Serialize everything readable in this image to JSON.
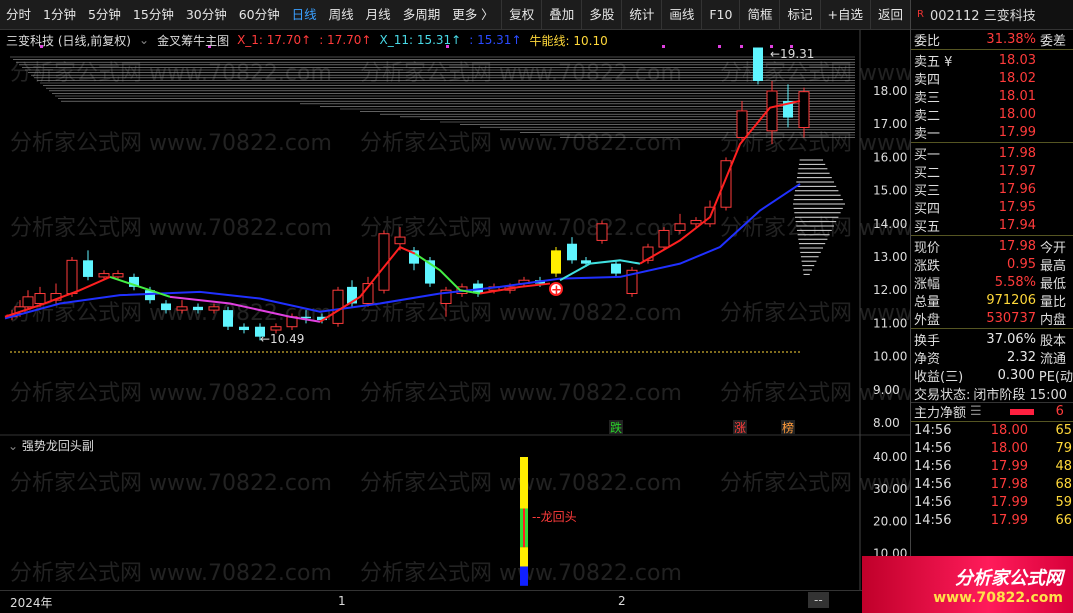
{
  "toolbar": {
    "periods": [
      "分时",
      "1分钟",
      "5分钟",
      "15分钟",
      "30分钟",
      "60分钟",
      "日线",
      "周线",
      "月线",
      "多周期",
      "更多 〉"
    ],
    "active_period": "日线",
    "right_buttons": [
      "复权",
      "叠加",
      "多股",
      "统计",
      "画线",
      "F10",
      "简框",
      "标记",
      "+自选",
      "返回"
    ]
  },
  "legend": {
    "stock_title": "三变科技 (日线,前复权)",
    "indicator_name": "金叉筹牛主图",
    "x1": "X_1: 17.70↑",
    "x1b": ": 17.70↑",
    "x11": "X_11: 15.31↑",
    "x11b": ": 15.31↑",
    "niuneng": "牛能线: 10.10"
  },
  "chart_labels": {
    "high_marker": "19.31",
    "low_marker": "10.49",
    "die": "跌",
    "zhang": "涨",
    "bang": "榜",
    "sub_indicator": "强势龙回头副",
    "dragon_label": "龙回头",
    "year": "2024年",
    "month1": "1",
    "month2": "2",
    "nav": "--"
  },
  "price_axis": [
    "18.00",
    "17.00",
    "16.00",
    "15.00",
    "14.00",
    "13.00",
    "12.00",
    "11.00",
    "10.00",
    "9.00",
    "8.00"
  ],
  "sub_axis": [
    "40.00",
    "30.00",
    "20.00",
    "10.00"
  ],
  "watermark": "分析家公式网 www.70822.com",
  "quote": {
    "badge": "R",
    "code": "002112 三变科技",
    "weibi_label": "委比",
    "weibi": "31.38%",
    "weicha_label": "委差",
    "asks": [
      {
        "label": "卖五 ¥",
        "price": "18.03"
      },
      {
        "label": "卖四",
        "price": "18.02"
      },
      {
        "label": "卖三",
        "price": "18.01"
      },
      {
        "label": "卖二",
        "price": "18.00"
      },
      {
        "label": "卖一",
        "price": "17.99"
      }
    ],
    "bids": [
      {
        "label": "买一",
        "price": "17.98"
      },
      {
        "label": "买二",
        "price": "17.97"
      },
      {
        "label": "买三",
        "price": "17.96"
      },
      {
        "label": "买四",
        "price": "17.95"
      },
      {
        "label": "买五",
        "price": "17.94"
      }
    ],
    "stats": [
      {
        "label": "现价",
        "value": "17.98",
        "extra": "今开",
        "cls": "red"
      },
      {
        "label": "涨跌",
        "value": "0.95",
        "extra": "最高",
        "cls": "red"
      },
      {
        "label": "涨幅",
        "value": "5.58%",
        "extra": "最低",
        "cls": "red"
      },
      {
        "label": "总量",
        "value": "971206",
        "extra": "量比",
        "cls": "yellow"
      },
      {
        "label": "外盘",
        "value": "530737",
        "extra": "内盘",
        "cls": "red"
      }
    ],
    "stats2": [
      {
        "label": "换手",
        "value": "37.06%",
        "extra": "股本",
        "cls": "white"
      },
      {
        "label": "净资",
        "value": "2.32",
        "extra": "流通",
        "cls": "white"
      },
      {
        "label": "收益(三)",
        "value": "0.300",
        "extra": "PE(动",
        "cls": "white"
      }
    ],
    "trade_status_label": "交易状态:",
    "trade_status": "闭市阶段 15:00",
    "main_flow_label": "主力净额",
    "main_flow_value": "6",
    "ticks": [
      {
        "t": "14:56",
        "p": "18.00",
        "v": "65"
      },
      {
        "t": "14:56",
        "p": "18.00",
        "v": "79"
      },
      {
        "t": "14:56",
        "p": "17.99",
        "v": "48"
      },
      {
        "t": "14:56",
        "p": "17.98",
        "v": "68"
      },
      {
        "t": "14:56",
        "p": "17.99",
        "v": "59"
      },
      {
        "t": "14:56",
        "p": "17.99",
        "v": "66"
      }
    ]
  },
  "logo": {
    "line1": "分析家公式网",
    "line2": "www.70822.com"
  }
}
